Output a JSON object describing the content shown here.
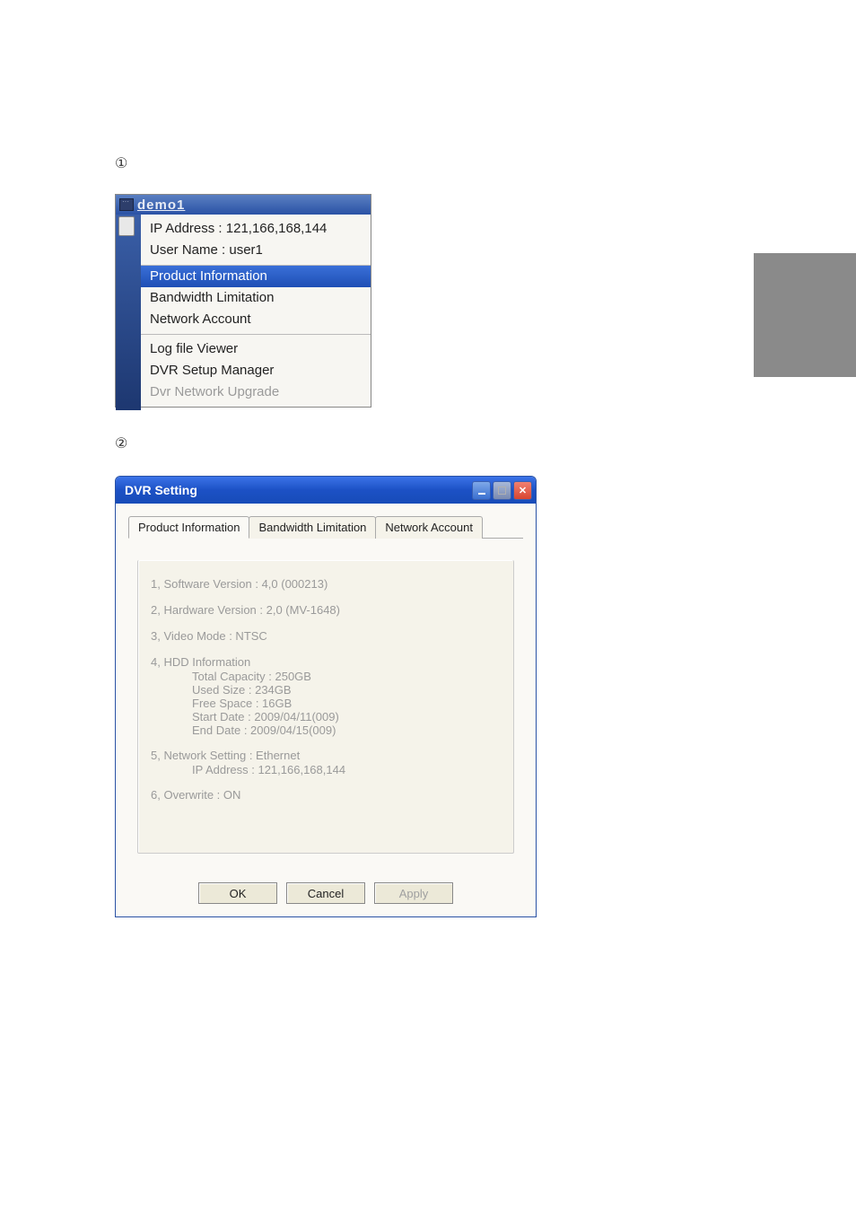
{
  "markers": {
    "one": "①",
    "two": "②"
  },
  "context_menu": {
    "title": "demo1",
    "info": {
      "ip_label": "IP Address : 121,166,168,144",
      "user_label": "User Name : user1"
    },
    "group2": {
      "product_info": "Product Information",
      "bandwidth": "Bandwidth Limitation",
      "network_account": "Network Account"
    },
    "group3": {
      "log_viewer": "Log file Viewer",
      "dvr_setup": "DVR Setup Manager",
      "dvr_upgrade": "Dvr Network Upgrade"
    }
  },
  "dvr_window": {
    "title": "DVR Setting",
    "tabs": {
      "product": "Product Information",
      "bandwidth": "Bandwidth Limitation",
      "network": "Network Account"
    },
    "info": {
      "line1": "1, Software Version : 4,0 (000213)",
      "line2": "2, Hardware Version : 2,0 (MV-1648)",
      "line3": "3, Video Mode : NTSC",
      "line4": "4, HDD Information",
      "hdd_total": "Total Capacity : 250GB",
      "hdd_used": "Used Size : 234GB",
      "hdd_free": "Free Space : 16GB",
      "hdd_start": "Start Date : 2009/04/11(009)",
      "hdd_end": "End Date : 2009/04/15(009)",
      "line5": "5, Network Setting : Ethernet",
      "net_ip": "IP Address : 121,166,168,144",
      "line6": "6, Overwrite : ON"
    },
    "buttons": {
      "ok": "OK",
      "cancel": "Cancel",
      "apply": "Apply"
    }
  }
}
